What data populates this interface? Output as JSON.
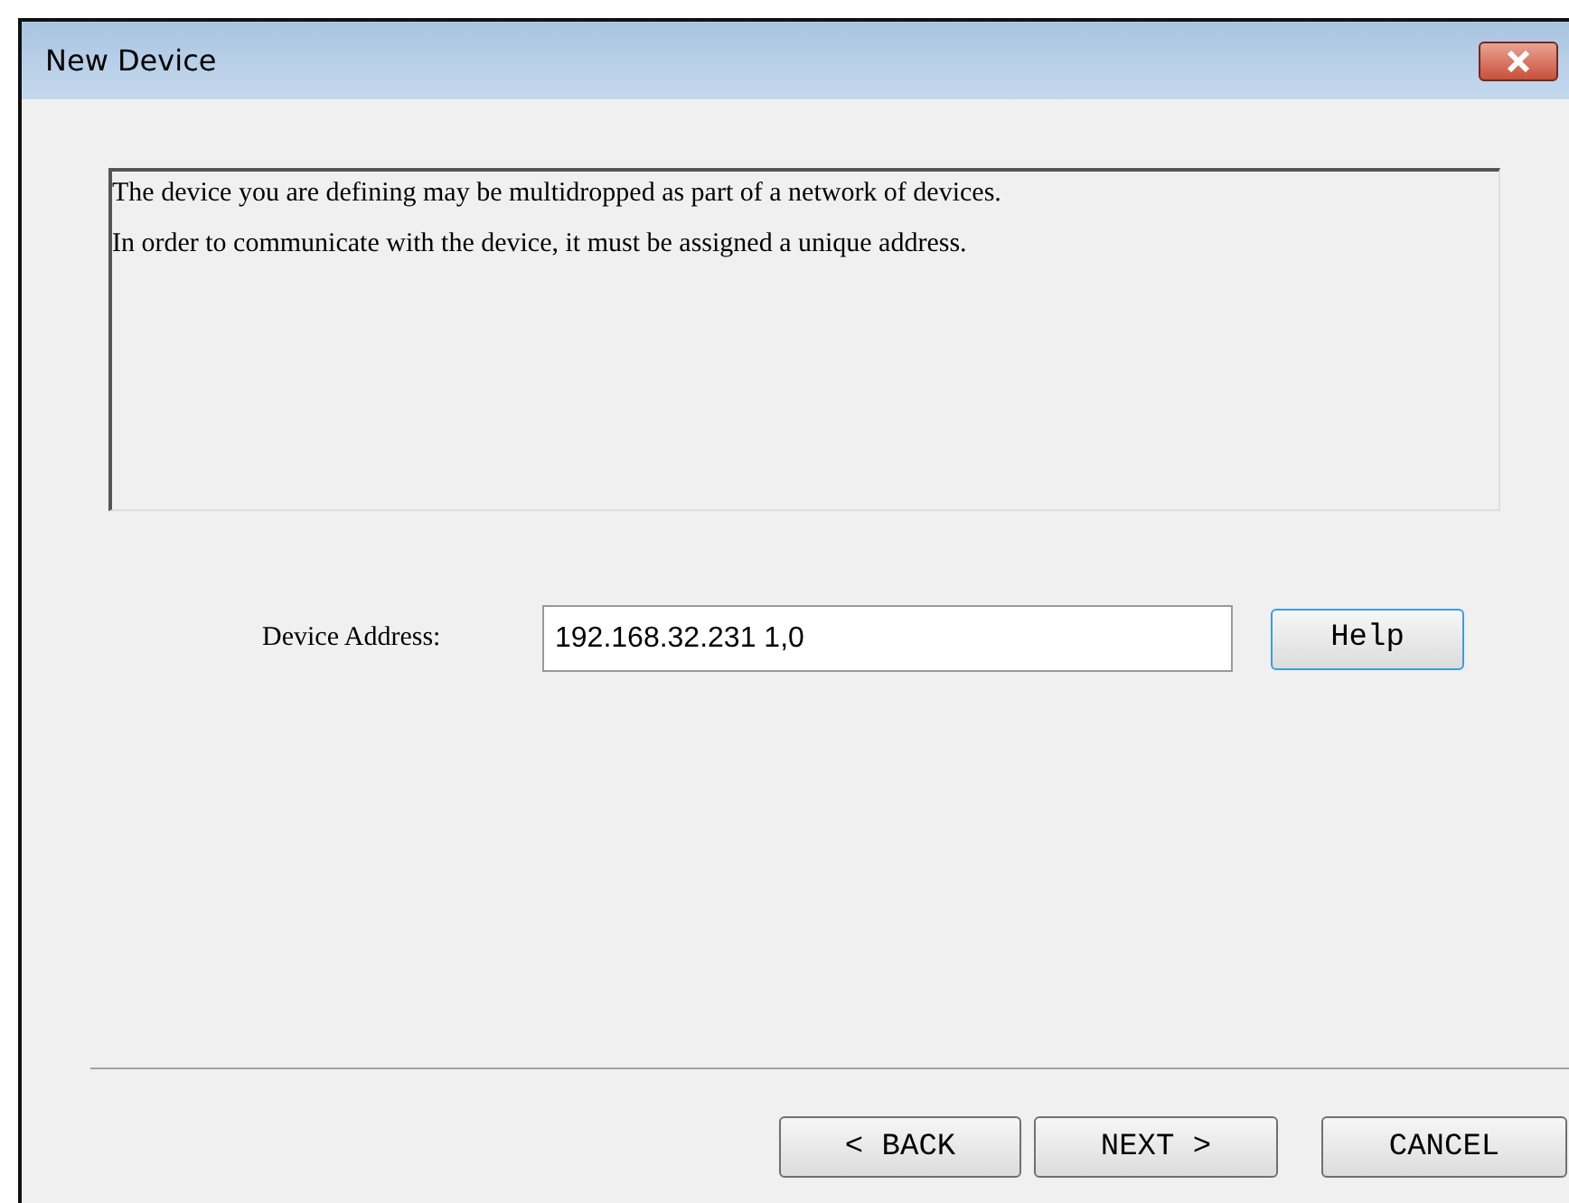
{
  "window": {
    "title": "New Device"
  },
  "message": [
    "The device you are defining may be multidropped as part of a network of devices.",
    "In order to communicate with the device, it must be assigned a unique address."
  ],
  "device_address": {
    "label": "Device Address:",
    "value": "192.168.32.231 1,0"
  },
  "help_button": "Help",
  "buttons": [
    {
      "label": "< BACK",
      "kind": "back"
    },
    {
      "label": "NEXT >",
      "kind": "next"
    },
    {
      "label": "CANCEL",
      "kind": "cancel"
    }
  ]
}
